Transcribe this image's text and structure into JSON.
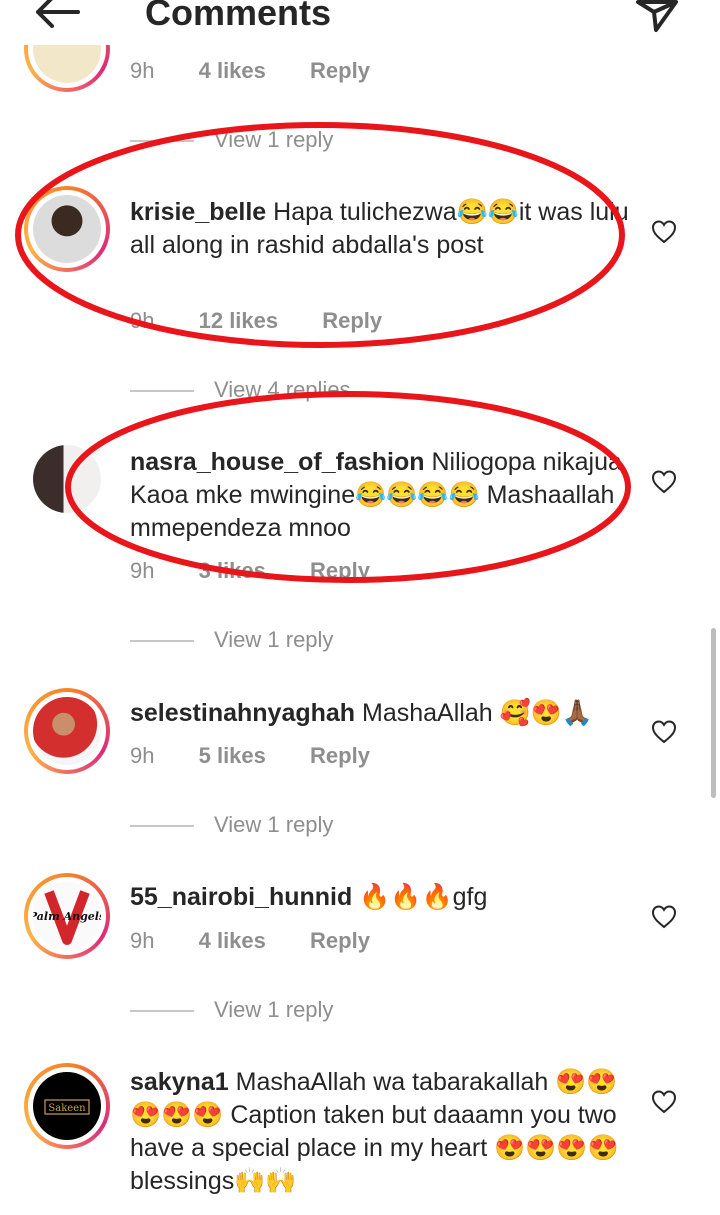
{
  "header": {
    "title": "Comments"
  },
  "partial_top": {
    "time": "9h",
    "likes": "4 likes",
    "reply": "Reply"
  },
  "comments": [
    {
      "username": "krisie_belle",
      "text": " Hapa tulichezwa😂😂it was lulu all along in rashid abdalla's post",
      "time": "9h",
      "likes": "12 likes",
      "reply": "Reply",
      "view_replies_above": "View 1 reply"
    },
    {
      "username": "nasra_house_of_fashion",
      "text": " Niliogopa nikajua Kaoa mke mwingine😂😂😂😂 Mashaallah mmependeza mnoo",
      "time": "9h",
      "likes": "3 likes",
      "reply": "Reply",
      "view_replies_above": "View 4 replies"
    },
    {
      "username": "selestinahnyaghah",
      "text": " MashaAllah 🥰😍🙏🏾",
      "time": "9h",
      "likes": "5 likes",
      "reply": "Reply",
      "view_replies_above": "View 1 reply"
    },
    {
      "username": "55_nairobi_hunnid",
      "text": " 🔥🔥🔥gfg",
      "time": "9h",
      "likes": "4 likes",
      "reply": "Reply",
      "view_replies_above": "View 1 reply"
    },
    {
      "username": "sakyna1",
      "text": " MashaAllah wa tabarakallah 😍😍😍😍😍 Caption taken but daaamn  you two have a special place in my heart 😍😍😍😍blessings🙌🙌",
      "view_replies_above": "View 1 reply"
    }
  ],
  "avatar_logos": {
    "palm_angels": "Palm Angels",
    "sakeen": "Sakeen"
  },
  "colors": {
    "highlight_red": "#e8151b",
    "meta_gray": "#8e8e8e",
    "text": "#262626"
  }
}
